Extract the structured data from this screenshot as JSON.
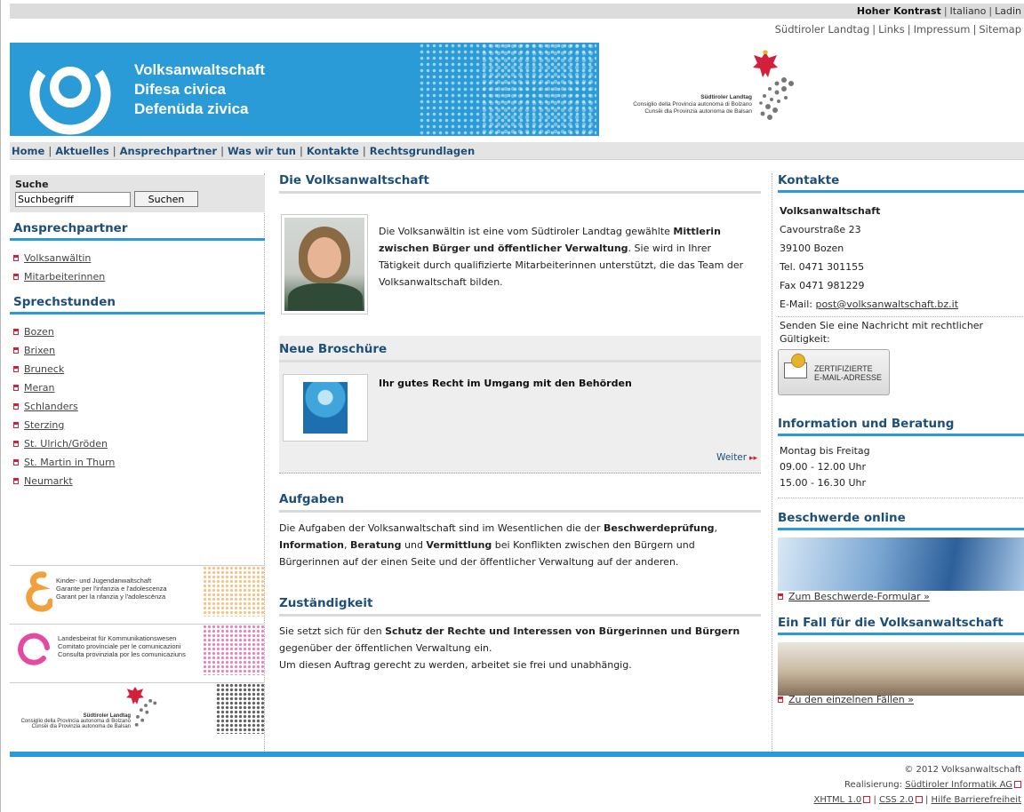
{
  "topbar": {
    "high_contrast": "Hoher Kontrast",
    "lang_it": "Italiano",
    "lang_ladin": "Ladin"
  },
  "metanav": {
    "items": [
      "Südtiroler Landtag",
      "Links",
      "Impressum",
      "Sitemap"
    ]
  },
  "header": {
    "brand_lines": [
      "Volksanwaltschaft",
      "Difesa civica",
      "Defenüda zivica"
    ],
    "landtag_lines": [
      "Südtiroler Landtag",
      "Consiglio della Provincia autonoma di Bolzano",
      "Cunsëi dla Provinzia autonoma de Balsan"
    ],
    "colors": {
      "blue": "#2a9bd6",
      "nav_text": "#1d4f7a",
      "bullet_red": "#d21f3c"
    }
  },
  "mainnav": {
    "items": [
      "Home",
      "Aktuelles",
      "Ansprechpartner",
      "Was wir tun",
      "Kontakte",
      "Rechtsgrundlagen"
    ]
  },
  "search": {
    "label": "Suche",
    "placeholder": "Suchbegriff",
    "button": "Suchen"
  },
  "left": {
    "ansprechpartner_title": "Ansprechpartner",
    "ansprechpartner_items": [
      "Volksanwältin",
      "Mitarbeiterinnen"
    ],
    "sprechstunden_title": "Sprechstunden",
    "sprechstunden_items": [
      "Bozen",
      "Brixen",
      "Bruneck",
      "Meran",
      "Schlanders",
      "Sterzing",
      "St. Ulrich/Gröden",
      "St. Martin in Thurn",
      "Neumarkt"
    ],
    "banners": [
      {
        "lines": [
          "Kinder- und Jugendanwaltschaft",
          "Garante per l'infanzia e l'adolescenza",
          "Garant per la nfanzia y l'adolescënza"
        ]
      },
      {
        "lines": [
          "Landesbeirat für Kommunikationswesen",
          "Comitato provinciale per le comunicazioni",
          "Consulta provinziala por les comunicaziuns"
        ]
      },
      {
        "lines": [
          "Südtiroler Landtag",
          "Consiglio della Provincia autonoma di Bolzano",
          "Cunsëi dla Provinzia autonoma de Balsan"
        ]
      }
    ]
  },
  "center": {
    "title": "Die Volksanwaltschaft",
    "intro_1": "Die Volksanwältin ist eine vom Südtiroler Landtag gewählte ",
    "intro_bold": "Mittlerin zwischen Bürger und öffentlicher Verwaltung",
    "intro_2": ". Sie wird in Ihrer Tätigkeit durch qualifizierte Mitarbeiterinnen unterstützt, die das Team der Volksanwaltschaft bilden.",
    "broschure_title": "Neue Broschüre",
    "broschure_item": "Ihr gutes Recht im Umgang mit den Behörden",
    "weiter": "Weiter",
    "aufgaben_title": "Aufgaben",
    "aufgaben_1": "Die Aufgaben der Volksanwaltschaft sind im Wesentlichen die der ",
    "aufgaben_b1": "Beschwerdeprüfung",
    "aufgaben_2": ", ",
    "aufgaben_b2": "Information",
    "aufgaben_3": ", ",
    "aufgaben_b3": "Beratung",
    "aufgaben_4": " und ",
    "aufgaben_b4": "Vermittlung",
    "aufgaben_5": " bei Konflikten zwischen den Bürgern und Bürgerinnen auf der einen Seite und der öffentlicher Verwaltung auf der anderen.",
    "zust_title": "Zuständigkeit",
    "zust_1": "Sie setzt sich für den ",
    "zust_bold": "Schutz der Rechte und Interessen von Bürgerinnen und Bürgern",
    "zust_2": " gegenüber der öffentlichen Verwaltung ein.",
    "zust_3": "Um diesen Auftrag gerecht zu werden, arbeitet sie frei und unabhängig."
  },
  "right": {
    "kontakte_title": "Kontakte",
    "org": "Volksanwaltschaft",
    "street": "Cavourstraße 23",
    "city": "39100 Bozen",
    "tel": "Tel. 0471 301155",
    "fax": "Fax 0471 981229",
    "email_label": "E-Mail: ",
    "email": "post@volksanwaltschaft.bz.it",
    "nachricht": "Senden Sie eine Nachricht mit rechtlicher Gültigkeit:",
    "zert_line1": "ZERTIFIZIERTE",
    "zert_line2": "E-MAIL-ADRESSE",
    "info_title": "Information und Beratung",
    "days": "Montag bis Freitag",
    "hours1": "09.00 - 12.00 Uhr",
    "hours2": "15.00 - 16.30 Uhr",
    "beschwerde_title": "Beschwerde online",
    "beschwerde_link": "Zum Beschwerde-Formular »",
    "fall_title": "Ein Fall für die Volksanwaltschaft",
    "fall_link": "Zu den einzelnen Fällen »"
  },
  "footer": {
    "copyright": "© 2012 Volksanwaltschaft",
    "realisierung_label": "Realisierung: ",
    "realisierung": "Südtiroler Informatik AG",
    "xhtml": "XHTML 1.0",
    "css": "CSS 2.0",
    "hilfe": "Hilfe Barrierefreiheit"
  }
}
